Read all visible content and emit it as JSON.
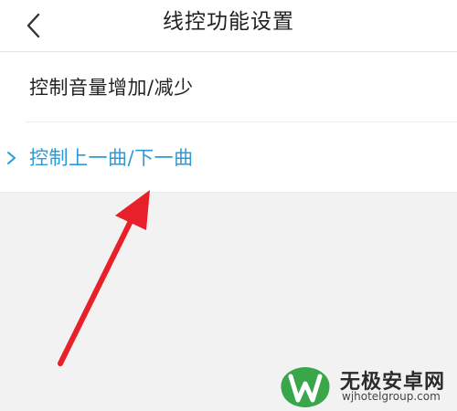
{
  "header": {
    "title": "线控功能设置",
    "back_icon": "chevron-left-icon"
  },
  "settings": {
    "items": [
      {
        "label": "控制音量增加/减少",
        "selected": false
      },
      {
        "label": "控制上一曲/下一曲",
        "selected": true
      }
    ],
    "selected_indicator_icon": "chevron-right-icon"
  },
  "watermark": {
    "title": "无极安卓网",
    "url": "wjhotelgroup.com"
  },
  "colors": {
    "accent": "#2a9ad8",
    "annotation_arrow": "#e8202a",
    "background": "#f2f2f2"
  }
}
